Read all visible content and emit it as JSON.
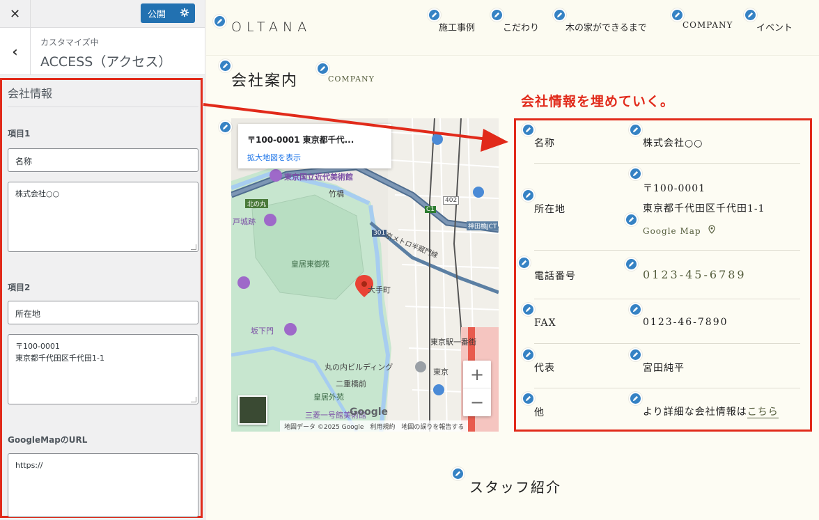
{
  "customizer": {
    "close_icon": "close-icon",
    "publish_label": "公開",
    "breadcrumb": "カスタマイズ中",
    "section_title": "ACCESS（アクセス）",
    "panel_title": "会社情報",
    "item1": {
      "label": "項目1",
      "name_value": "名称",
      "content_value": "株式会社○○"
    },
    "item2": {
      "label": "項目2",
      "name_value": "所在地",
      "content_value": "〒100-0001\n東京都千代田区千代田1-1"
    },
    "gmap": {
      "label": "GoogleMapのURL",
      "value": "https://"
    }
  },
  "site": {
    "logo": "OLTANA",
    "nav": [
      "施工事例",
      "こだわり",
      "木の家ができるまで",
      "COMPANY",
      "イベント"
    ],
    "section_title": "会社案内",
    "section_sub": "COMPANY",
    "annotation": "会社情報を埋めていく。",
    "staff_title": "スタッフ紹介"
  },
  "map": {
    "card_address": "〒100-0001 東京都千代...",
    "card_link": "拡大地図を表示",
    "labels": [
      "東京国立近代美術館",
      "竹橋",
      "北の丸",
      "戸城跡",
      "皇居東御苑",
      "大手町",
      "坂下門",
      "東京駅一番街",
      "丸の内ビルディング",
      "二重橋前",
      "皇居外苑",
      "三菱一号館美術館",
      "東京",
      "神田橋JCT",
      "東京メトロ半蔵門線",
      "402",
      "301",
      "C1"
    ],
    "attribution": "地図データ ©2025 Google　利用規約　地図の誤りを報告する",
    "google": "Google",
    "zoom_in": "+",
    "zoom_out": "−"
  },
  "company": {
    "rows": [
      {
        "label": "名称",
        "value": "株式会社○○"
      },
      {
        "label": "所在地",
        "value_line1": "〒100-0001",
        "value_line2": "東京都千代田区千代田1-1",
        "link": "Google Map"
      },
      {
        "label": "電話番号",
        "value": "0123-45-6789"
      },
      {
        "label": "FAX",
        "value": "0123-46-7890"
      },
      {
        "label": "代表",
        "value": "宮田純平"
      },
      {
        "label": "他",
        "value_prefix": "より詳細な会社情報は",
        "link": "こちら"
      }
    ]
  },
  "colors": {
    "accent_red": "#e12a1a",
    "wp_blue": "#2271b1",
    "olive": "#555d3c",
    "page_bg": "#fdfcf3"
  }
}
